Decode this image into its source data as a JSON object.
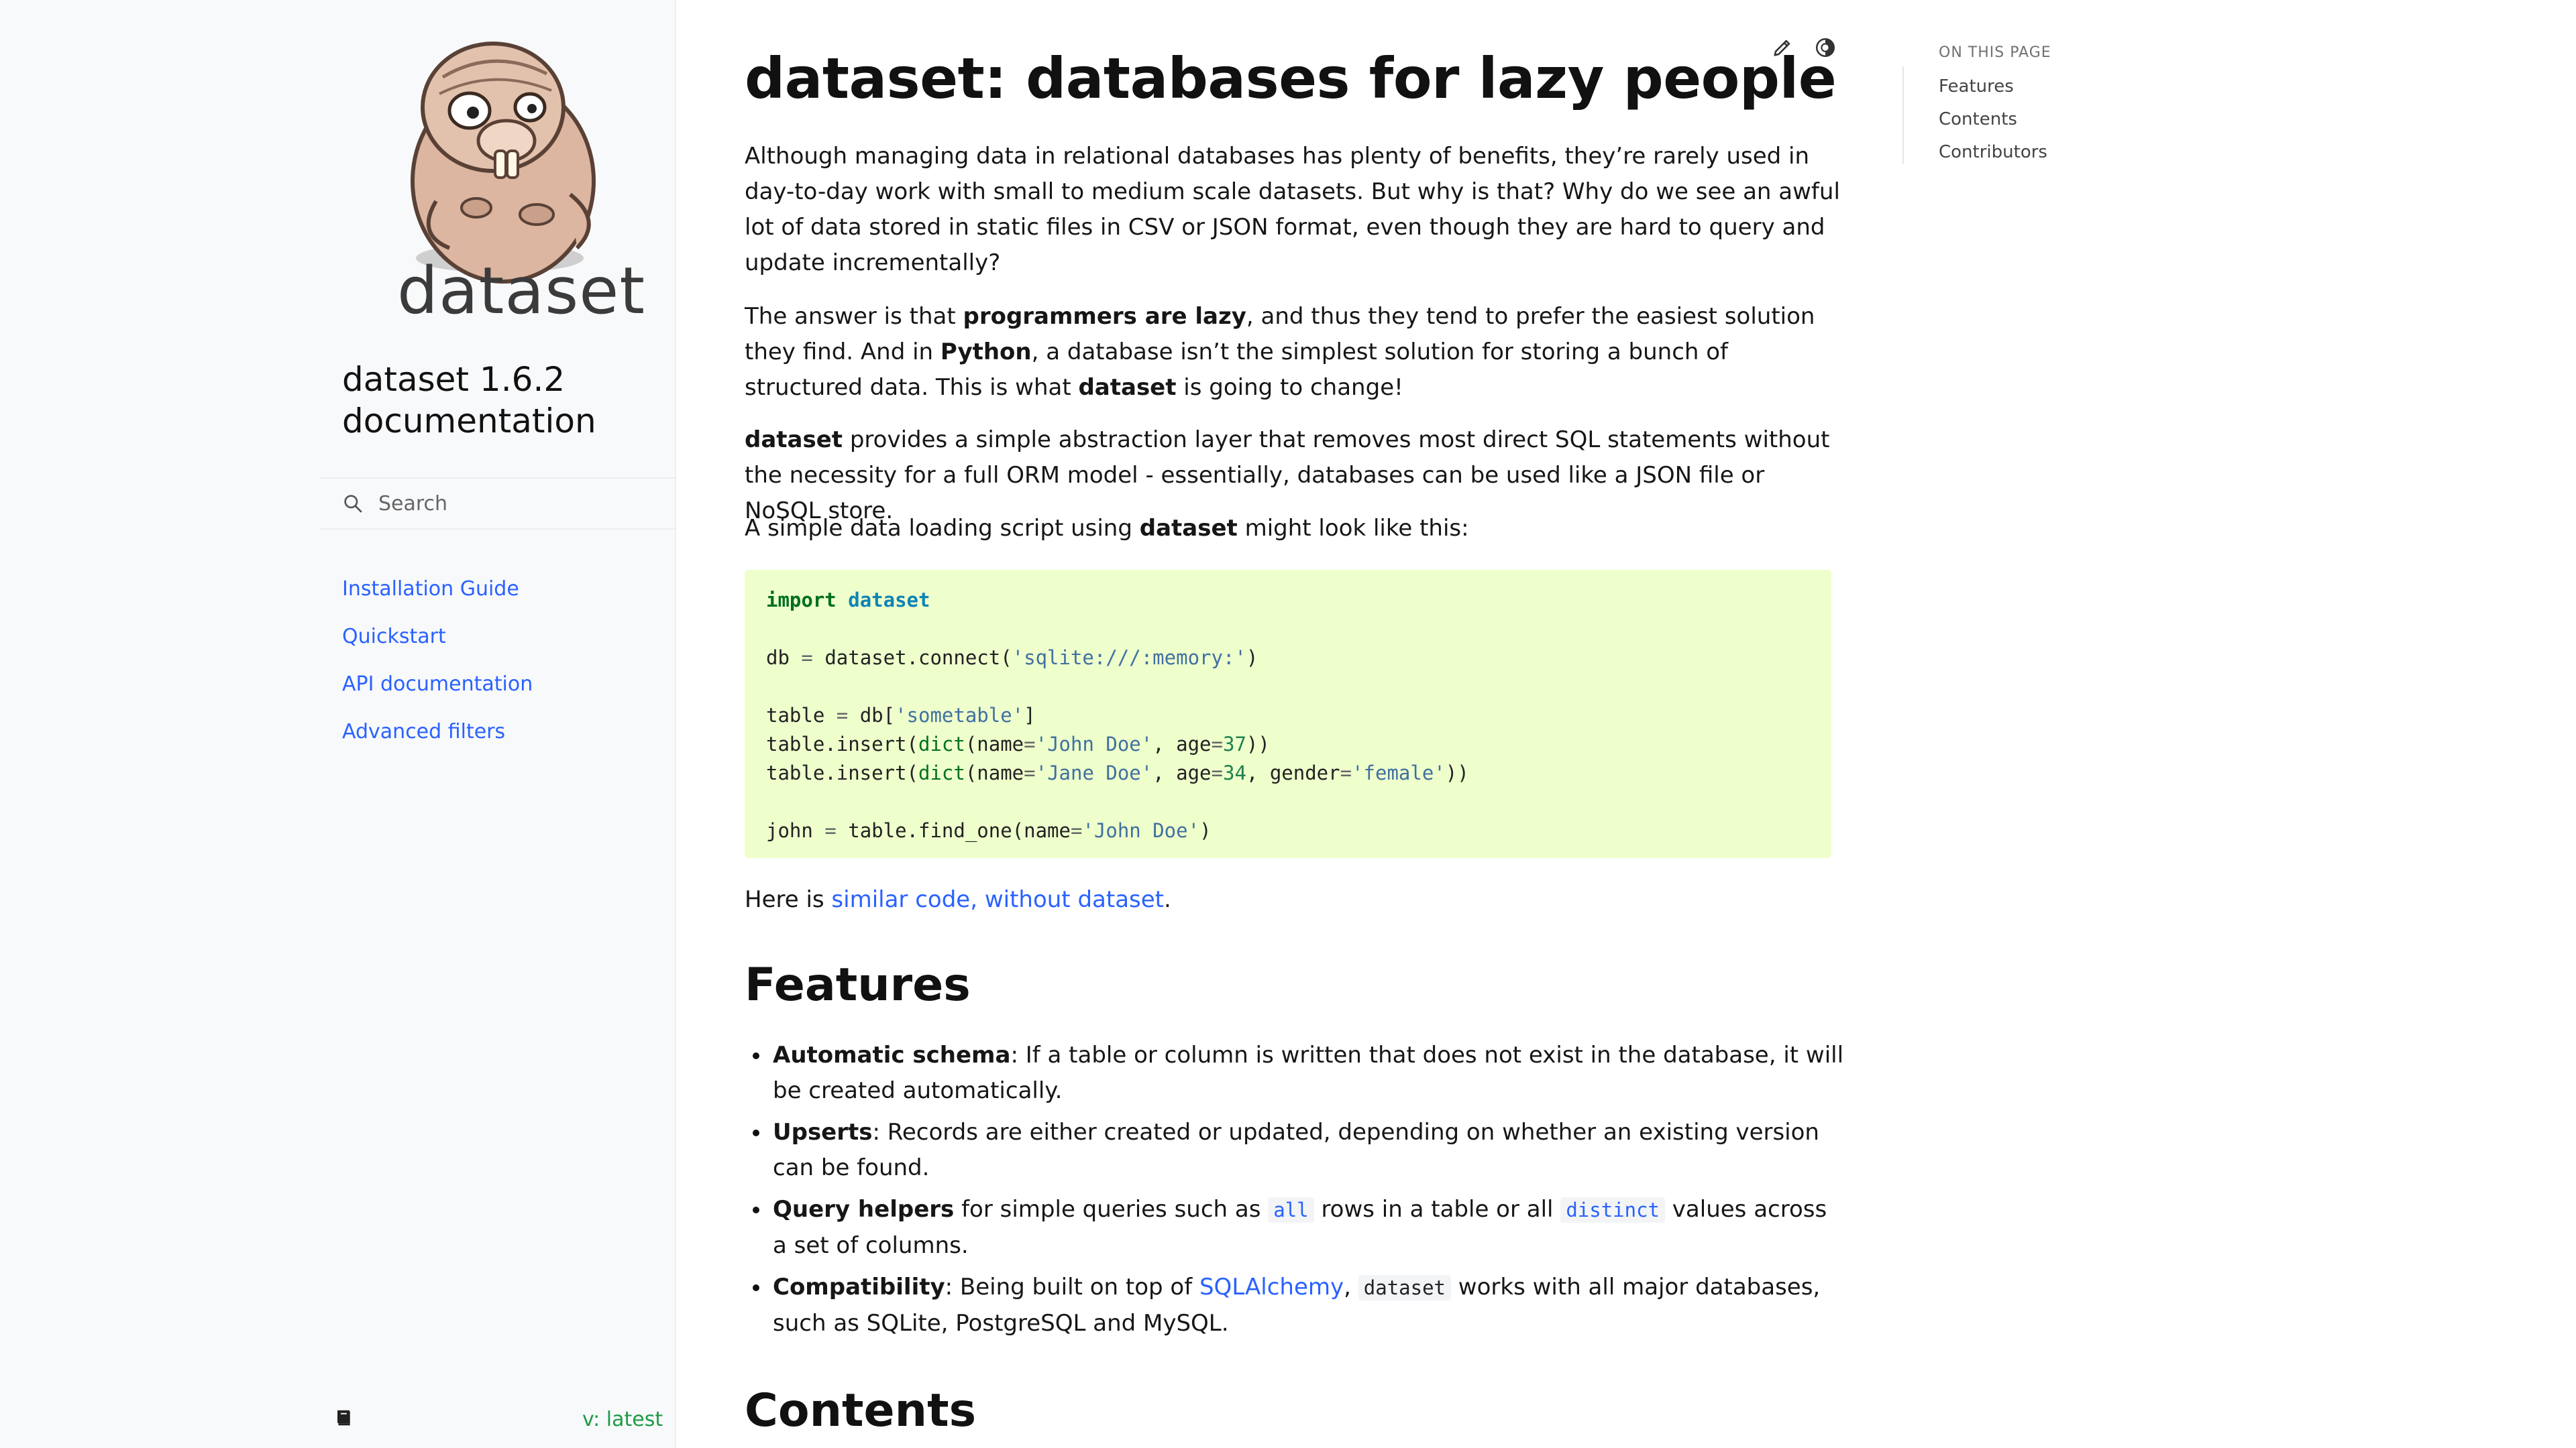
{
  "sidebar": {
    "logo_word": "dataset",
    "project_title": "dataset 1.6.2 documentation",
    "search": {
      "placeholder": "Search"
    },
    "nav": [
      {
        "label": "Installation Guide"
      },
      {
        "label": "Quickstart"
      },
      {
        "label": "API documentation"
      },
      {
        "label": "Advanced filters"
      }
    ],
    "footer": {
      "book_icon": "book-icon",
      "version": "v: latest"
    }
  },
  "main": {
    "title": "dataset: databases for lazy people",
    "actions": {
      "edit_icon": "pencil-icon",
      "theme_icon": "contrast-icon"
    },
    "intro": {
      "p1": "Although managing data in relational databases has plenty of benefits, they’re rarely used in day-to-day work with small to medium scale datasets. But why is that? Why do we see an awful lot of data stored in static files in CSV or JSON format, even though they are hard to query and update incrementally?",
      "p2_a": "The answer is that ",
      "p2_b": "programmers are lazy",
      "p2_c": ", and thus they tend to prefer the easiest solution they find. And in ",
      "p2_d": "Python",
      "p2_e": ", a database isn’t the simplest solution for storing a bunch of structured data. This is what ",
      "p2_f": "dataset",
      "p2_g": " is going to change!",
      "p3_a": "dataset",
      "p3_b": " provides a simple abstraction layer that removes most direct SQL statements without the necessity for a full ORM model - essentially, databases can be used like a JSON file or NoSQL store.",
      "p4_a": "A simple data loading script using ",
      "p4_b": "dataset",
      "p4_c": " might look like this:",
      "p5_a": "Here is ",
      "p5_link": "similar code, without dataset",
      "p5_c": "."
    },
    "code": {
      "l1_kw": "import",
      "l1_mod": "dataset",
      "l3_a": "db ",
      "l3_op": "=",
      "l3_b": " dataset.connect(",
      "l3_str": "'sqlite:///:memory:'",
      "l3_c": ")",
      "l5_a": "table ",
      "l5_op": "=",
      "l5_b": " db[",
      "l5_str": "'sometable'",
      "l5_c": "]",
      "l6_a": "table.insert(",
      "l6_bi": "dict",
      "l6_b": "(name",
      "l6_op1": "=",
      "l6_str": "'John Doe'",
      "l6_c": ", age",
      "l6_op2": "=",
      "l6_num": "37",
      "l6_d": "))",
      "l7_a": "table.insert(",
      "l7_bi": "dict",
      "l7_b": "(name",
      "l7_op1": "=",
      "l7_str1": "'Jane Doe'",
      "l7_c": ", age",
      "l7_op2": "=",
      "l7_num": "34",
      "l7_d": ", gender",
      "l7_op3": "=",
      "l7_str2": "'female'",
      "l7_e": "))",
      "l9_a": "john ",
      "l9_op1": "=",
      "l9_b": " table.find_one(name",
      "l9_op2": "=",
      "l9_str": "'John Doe'",
      "l9_c": ")"
    },
    "features": {
      "heading": "Features",
      "items": [
        {
          "bold": "Automatic schema",
          "text": ": If a table or column is written that does not exist in the database, it will be created automatically."
        },
        {
          "bold": "Upserts",
          "text": ": Records are either created or updated, depending on whether an existing version can be found."
        },
        {
          "bold": "Query helpers",
          "text_a": " for simple queries such as ",
          "code1": "all",
          "text_b": " rows in a table or all ",
          "code2": "distinct",
          "text_c": " values across a set of columns."
        },
        {
          "bold": "Compatibility",
          "text_a": ": Being built on top of ",
          "link": "SQLAlchemy",
          "text_b": ", ",
          "code": "dataset",
          "text_c": " works with all major databases, such as SQLite, PostgreSQL and MySQL."
        }
      ]
    },
    "contents": {
      "heading": "Contents"
    }
  },
  "toc": {
    "label": "ON THIS PAGE",
    "items": [
      {
        "label": "Features"
      },
      {
        "label": "Contents"
      },
      {
        "label": "Contributors"
      }
    ]
  }
}
